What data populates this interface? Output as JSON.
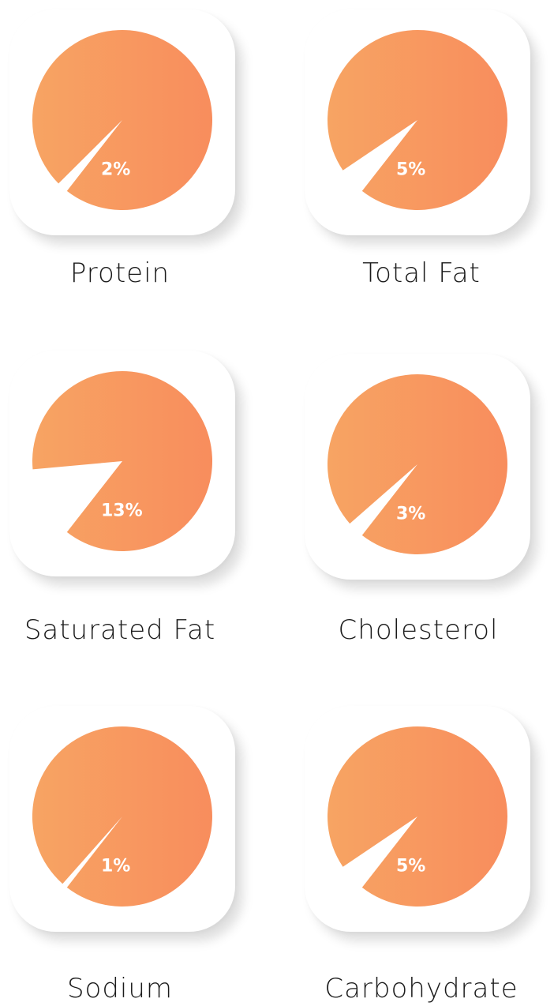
{
  "chart_data": [
    {
      "type": "pie",
      "title": "Protein",
      "values": [
        2
      ],
      "labels": [
        "2%"
      ]
    },
    {
      "type": "pie",
      "title": "Total Fat",
      "values": [
        5
      ],
      "labels": [
        "5%"
      ]
    },
    {
      "type": "pie",
      "title": "Saturated Fat",
      "values": [
        13
      ],
      "labels": [
        "13%"
      ]
    },
    {
      "type": "pie",
      "title": "Cholesterol",
      "values": [
        3
      ],
      "labels": [
        "3%"
      ]
    },
    {
      "type": "pie",
      "title": "Sodium",
      "values": [
        1
      ],
      "labels": [
        "1%"
      ]
    },
    {
      "type": "pie",
      "title": "Carbohydrate",
      "values": [
        5
      ],
      "labels": [
        "5%"
      ]
    }
  ],
  "colors": {
    "gradient_start": "#f7a463",
    "gradient_end": "#f88d5d",
    "label_text": "#1b1b1b",
    "percent_text": "#ffffff",
    "card_background": "#ffffff"
  }
}
